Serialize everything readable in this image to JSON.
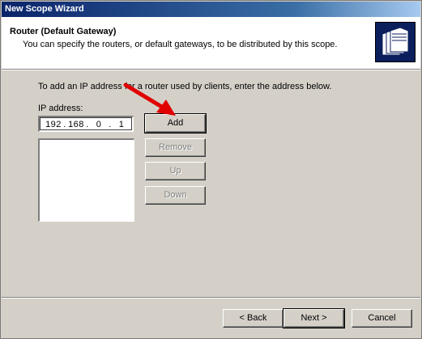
{
  "window": {
    "title": "New Scope Wizard"
  },
  "header": {
    "title": "Router (Default Gateway)",
    "subtitle": "You can specify the routers, or default gateways, to be distributed by this scope.",
    "icon": "folder-stack-icon"
  },
  "body": {
    "instruction": "To add an IP address for a router used by clients, enter the address below.",
    "ip_label": "IP address:",
    "ip_octets": [
      "192",
      "168",
      "0",
      "1"
    ],
    "ip_dots": [
      ".",
      ".",
      "."
    ]
  },
  "buttons": {
    "add": "Add",
    "remove": "Remove",
    "up": "Up",
    "down": "Down"
  },
  "nav": {
    "back": "< Back",
    "next": "Next >",
    "cancel": "Cancel"
  },
  "colors": {
    "titlebar": "#0a246a",
    "dialog": "#d4d0c8",
    "arrow": "#e00000"
  }
}
